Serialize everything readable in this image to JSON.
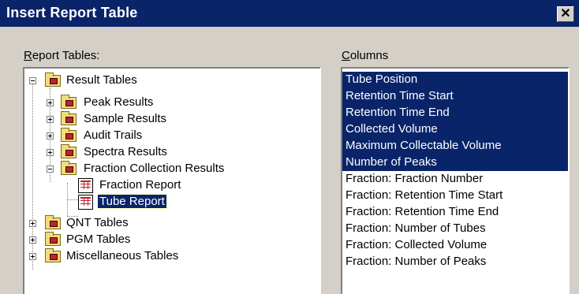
{
  "window": {
    "title": "Insert Report Table",
    "close_glyph": "✕"
  },
  "labels": {
    "report_tables_first": "R",
    "report_tables_rest": "eport Tables:",
    "columns_first": "C",
    "columns_rest": "olumns"
  },
  "tree": {
    "result_tables": "Result Tables",
    "peak_results": "Peak Results",
    "sample_results": "Sample Results",
    "audit_trails": "Audit Trails",
    "spectra_results": "Spectra Results",
    "fraction_collection_results": "Fraction Collection Results",
    "fraction_report": "Fraction Report",
    "tube_report": "Tube Report",
    "qnt_tables": "QNT Tables",
    "pgm_tables": "PGM Tables",
    "miscellaneous_tables": "Miscellaneous Tables"
  },
  "columns": [
    {
      "label": "Tube Position",
      "selected": true
    },
    {
      "label": "Retention Time Start",
      "selected": true
    },
    {
      "label": "Retention Time End",
      "selected": true
    },
    {
      "label": "Collected Volume",
      "selected": true
    },
    {
      "label": "Maximum Collectable Volume",
      "selected": true
    },
    {
      "label": "Number of Peaks",
      "selected": true
    },
    {
      "label": "Fraction: Fraction Number",
      "selected": false
    },
    {
      "label": "Fraction: Retention Time Start",
      "selected": false
    },
    {
      "label": "Fraction: Retention Time End",
      "selected": false
    },
    {
      "label": "Fraction: Number of Tubes",
      "selected": false
    },
    {
      "label": "Fraction: Collected Volume",
      "selected": false
    },
    {
      "label": "Fraction: Number of Peaks",
      "selected": false
    }
  ],
  "colors": {
    "selection": "#0a246a",
    "titlebar": "#0a246a",
    "dialog": "#d4d0c8"
  }
}
